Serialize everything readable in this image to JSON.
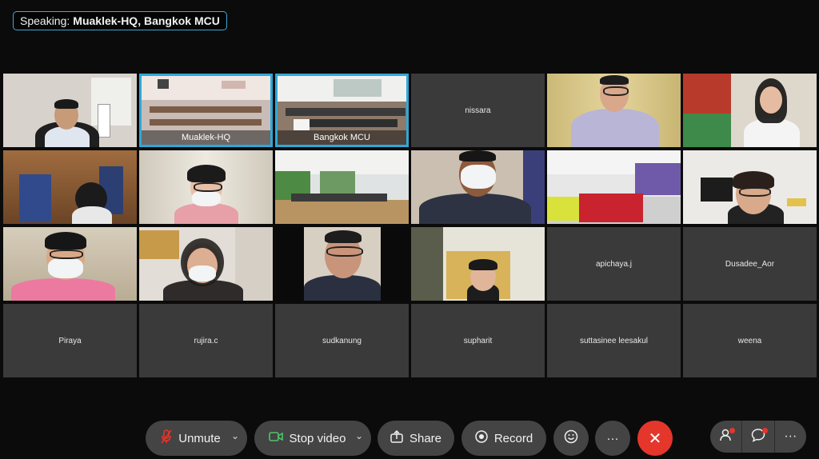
{
  "speaking": {
    "prefix": "Speaking:",
    "names": "Muaklek-HQ, Bangkok MCU"
  },
  "tiles": [
    {
      "name": "video-1",
      "label": ""
    },
    {
      "name": "video-2",
      "label": "Muaklek-HQ"
    },
    {
      "name": "video-3",
      "label": "Bangkok MCU"
    },
    {
      "name": "nissara",
      "label": "nissara"
    },
    {
      "name": "video-5",
      "label": ""
    },
    {
      "name": "video-6",
      "label": ""
    },
    {
      "name": "video-7",
      "label": ""
    },
    {
      "name": "video-8",
      "label": ""
    },
    {
      "name": "video-9",
      "label": ""
    },
    {
      "name": "video-10",
      "label": ""
    },
    {
      "name": "video-11",
      "label": ""
    },
    {
      "name": "video-12",
      "label": ""
    },
    {
      "name": "video-13",
      "label": ""
    },
    {
      "name": "video-14",
      "label": ""
    },
    {
      "name": "video-15",
      "label": ""
    },
    {
      "name": "video-16",
      "label": ""
    },
    {
      "name": "apichaya",
      "label": "apichaya.j"
    },
    {
      "name": "dusadee",
      "label": "Dusadee_Aor"
    },
    {
      "name": "piraya",
      "label": "Piraya"
    },
    {
      "name": "rujira",
      "label": "rujira.c"
    },
    {
      "name": "sudkanung",
      "label": "sudkanung"
    },
    {
      "name": "supharit",
      "label": "supharit"
    },
    {
      "name": "suttasinee",
      "label": "suttasinee leesakul"
    },
    {
      "name": "weena",
      "label": "weena"
    }
  ],
  "toolbar": {
    "unmute": "Unmute",
    "stop_video": "Stop video",
    "share": "Share",
    "record": "Record",
    "more": "···",
    "end": "✕",
    "reactions_icon": "smiley-icon",
    "participants_icon": "participants-icon",
    "chat_icon": "chat-icon",
    "menu_icon": "more-icon"
  },
  "colors": {
    "accent": "#2fa8d8",
    "end_call": "#e5362c",
    "tile_bg": "#3a3a3a",
    "button_bg": "#444444"
  }
}
